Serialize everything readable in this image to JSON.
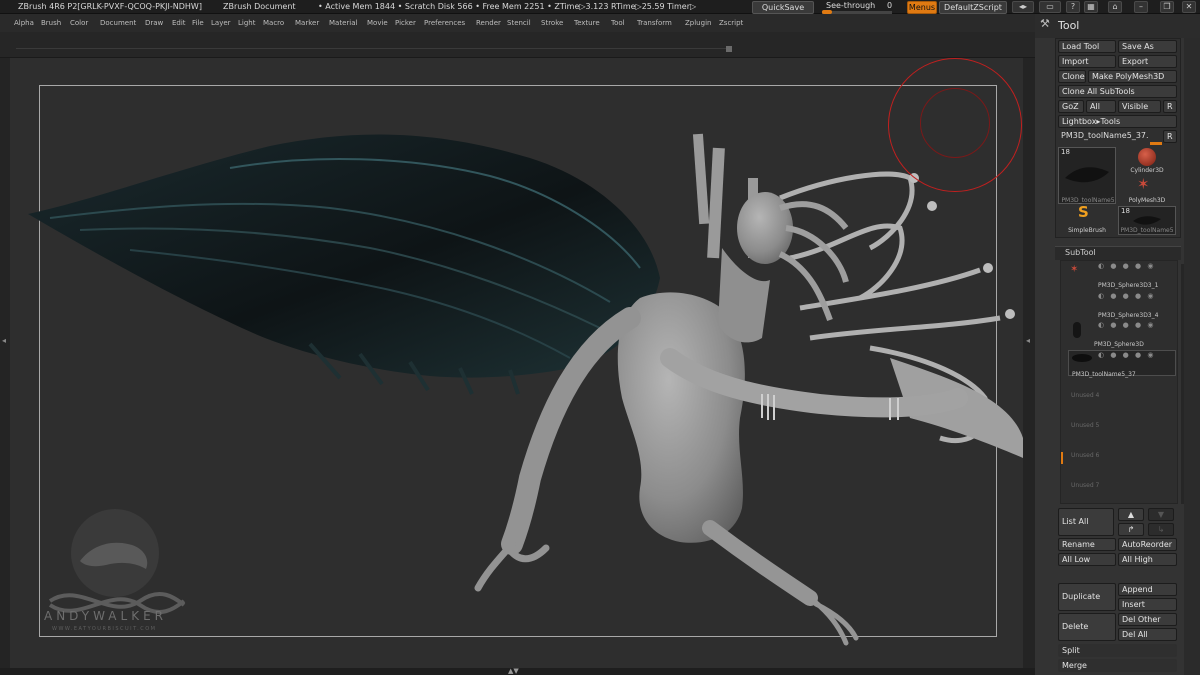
{
  "titlebar": {
    "app": "ZBrush 4R6  P2[GRLK-PVXF-QCOQ-PKJI-NDHW]",
    "document": "ZBrush Document",
    "stats": "• Active Mem 1844 • Scratch Disk 566 • Free Mem 2251 • ZTime▷3.123  RTime▷25.59  Timer▷",
    "quicksave": "QuickSave",
    "seethrough": "See-through",
    "seethrough_value": "0",
    "menus": "Menus",
    "default_zscript": "DefaultZScript",
    "accent": "#e07a12"
  },
  "menubar": {
    "items": [
      "Alpha",
      "Brush",
      "Color",
      "Document",
      "Draw",
      "Edit",
      "File",
      "Layer",
      "Light",
      "Macro",
      "Marker",
      "Material",
      "Movie",
      "Picker",
      "Preferences",
      "Render",
      "Stencil",
      "Stroke",
      "Texture",
      "Tool",
      "Transform",
      "Zplugin",
      "Zscript"
    ]
  },
  "watermark": {
    "name": "ANDYWALKER",
    "url": "WWW.EATYOURBISCUIT.COM"
  },
  "tool": {
    "title": "Tool",
    "load_tool": "Load Tool",
    "save_as": "Save As",
    "import": "Import",
    "export": "Export",
    "clone": "Clone",
    "make_polymesh": "Make PolyMesh3D",
    "clone_all_subtools": "Clone All SubTools",
    "goz": "GoZ",
    "all": "All",
    "visible": "Visible",
    "r": "R",
    "lightbox_tools": "Lightbox▸Tools",
    "tool_name": "PM3D_toolName5_37.",
    "thumbs": [
      {
        "label": "PM3D_toolName5",
        "count": "18"
      },
      {
        "label": "Cylinder3D"
      },
      {
        "label": "PolyMesh3D"
      },
      {
        "label": "SimpleBrush"
      },
      {
        "label": "PM3D_toolName5",
        "count": "18"
      }
    ]
  },
  "subtool": {
    "title": "SubTool",
    "items": [
      {
        "name": "PM3D_Sphere3D3_1"
      },
      {
        "name": "PM3D_Sphere3D3_4"
      },
      {
        "name": "PM3D_Sphere3D"
      },
      {
        "name": "PM3D_toolName5_37"
      }
    ],
    "unused": [
      "Unused 4",
      "Unused 5",
      "Unused 6",
      "Unused 7"
    ],
    "list_all": "List All",
    "rename": "Rename",
    "auto_reorder": "AutoReorder",
    "all_low": "All Low",
    "all_high": "All High",
    "duplicate": "Duplicate",
    "append": "Append",
    "insert": "Insert",
    "delete": "Delete",
    "del_other": "Del Other",
    "del_all": "Del All",
    "split": "Split",
    "merge": "Merge"
  }
}
